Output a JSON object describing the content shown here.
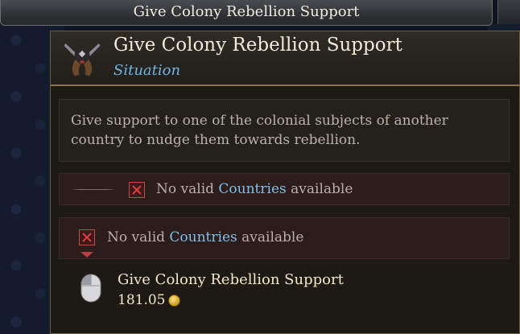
{
  "topbar": {
    "title": "Give Colony Rebellion Support"
  },
  "tooltip": {
    "title": "Give Colony Rebellion Support",
    "subtitle": "Situation",
    "description": "Give support to one of the colonial subjects of another country to nudge them towards rebellion.",
    "requirements": [
      {
        "prefix": "No valid ",
        "highlight": "Countries",
        "suffix": " available",
        "status": "failed"
      },
      {
        "prefix": "No valid ",
        "highlight": "Countries",
        "suffix": " available",
        "status": "failed"
      }
    ],
    "action": {
      "label": "Give Colony Rebellion Support",
      "cost": "181.05",
      "cost_icon": "gold-coin-icon",
      "input_icon": "mouse-left-click-icon"
    }
  },
  "colors": {
    "accent_blue": "#7fbfe8",
    "fail_red": "#e04040",
    "border_gold": "#8a7448"
  }
}
